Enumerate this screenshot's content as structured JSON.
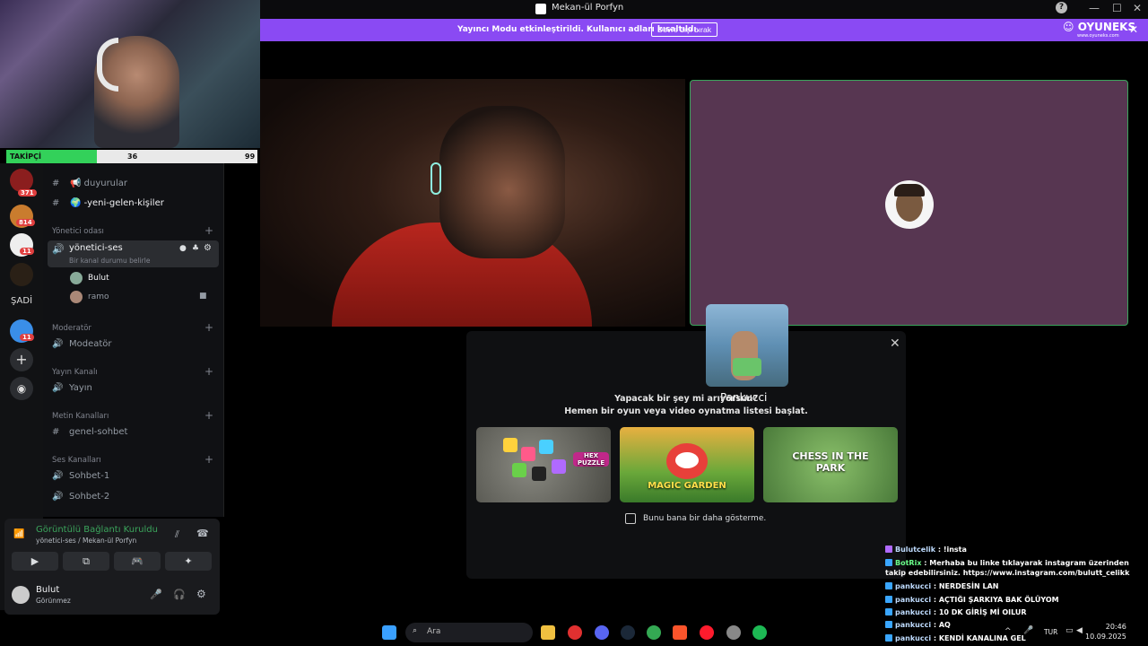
{
  "window": {
    "title": "Mekan-ül Porfyn"
  },
  "banner": {
    "text": "Yayıncı Modu etkinleştirildi. Kullanıcı adları kısaltıldı.",
    "button": "Devre dışı bırak",
    "logo": "OYUNEKS",
    "logo_url": "www.oyuneks.com"
  },
  "takipci": {
    "label": "TAKİPÇİ",
    "current": "36",
    "goal": "99",
    "progress": 0.36
  },
  "servers": {
    "badges": [
      "371",
      "814",
      "11",
      "11"
    ],
    "text_server": "ŞADİ"
  },
  "channels": {
    "top_hash": "",
    "duyurular": "📢 duyurular",
    "yeni_gelen": "🌍 -yeni-gelen-kişiler",
    "cat_yonetici": "Yönetici odası",
    "yonetici_ses": "yönetici-ses",
    "status_hint": "Bir kanal durumu belirle",
    "member_bulut": "Bulut",
    "member_ramo": "ramo",
    "cat_moderator": "Moderatör",
    "ch_moderator": "Modeatör",
    "cat_yayin": "Yayın Kanalı",
    "ch_yayin": "Yayın",
    "cat_metin": "Metin Kanalları",
    "ch_genel": "genel-sohbet",
    "cat_ses": "Ses Kanalları",
    "ch_sohbet1": "Sohbet-1",
    "ch_sohbet2": "Sohbet-2"
  },
  "voice_panel": {
    "status": "Görüntülü Bağlantı Kuruldu",
    "location": "yönetici-ses / Mekan-ül Porfyn",
    "user_name": "Bulut",
    "user_status": "Görünmez"
  },
  "activity": {
    "name": "Pankucci",
    "line1": "Yapacak bir şey mi arıyorsun?",
    "line2": "Hemen bir oyun veya video oynatma listesi başlat.",
    "games": [
      "HEX PUZZLE",
      "MAGIC GARDEN",
      "CHESS IN THE PARK"
    ],
    "checkbox_label": "Bunu bana bir daha gösterme."
  },
  "chat": [
    {
      "user": "Bulutcelik",
      "text": "!insta"
    },
    {
      "user": "BotRix",
      "text": "Merhaba bu linke tıklayarak instagram üzerinden takip edebilirsiniz. https://www.instagram.com/bulutt_celikk"
    },
    {
      "user": "pankucci",
      "text": "NERDESİN LAN"
    },
    {
      "user": "pankucci",
      "text": "AÇTIĞI ŞARKIYA BAK ÖLÜYOM"
    },
    {
      "user": "pankucci",
      "text": "10 DK GİRİŞ Mİ OILUR"
    },
    {
      "user": "pankucci",
      "text": "AQ"
    },
    {
      "user": "pankucci",
      "text": "KENDİ KANALINA GEL"
    }
  ],
  "taskbar": {
    "search": "Ara",
    "lang": "TUR",
    "time": "20:46",
    "date": "10.09.2025"
  },
  "colors": {
    "banner": "#8a4af3",
    "voice_connected": "#3ba55c",
    "tile_bg": "#573651"
  }
}
